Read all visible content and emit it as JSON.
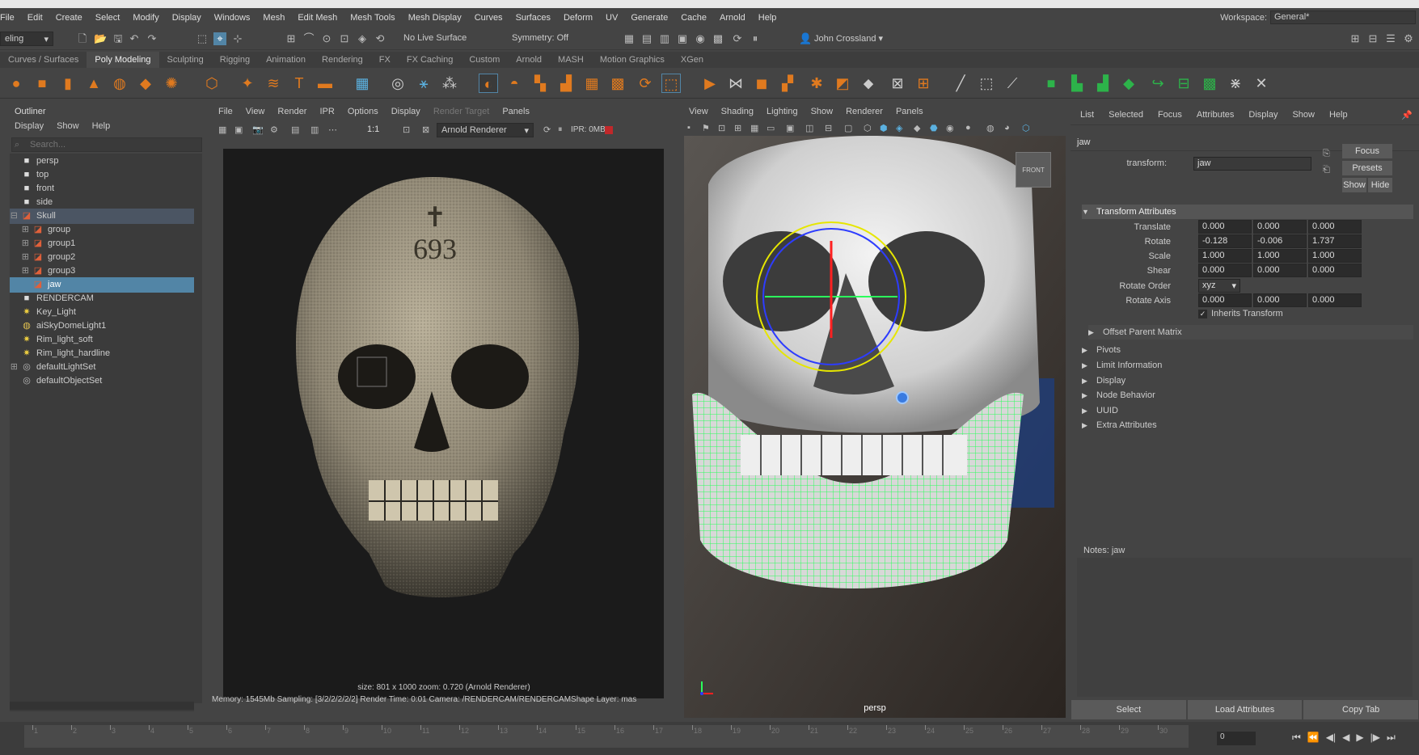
{
  "menubar": {
    "items": [
      "File",
      "Edit",
      "Create",
      "Select",
      "Modify",
      "Display",
      "Windows",
      "Mesh",
      "Edit Mesh",
      "Mesh Tools",
      "Mesh Display",
      "Curves",
      "Surfaces",
      "Deform",
      "UV",
      "Generate",
      "Cache",
      "Arnold",
      "Help"
    ],
    "workspace_label": "Workspace:",
    "workspace_value": "General*"
  },
  "toolbar": {
    "mode": "eling",
    "live_surface": "No Live Surface",
    "symmetry": "Symmetry: Off",
    "user": "John Crossland"
  },
  "shelf": {
    "tabs": [
      "Curves / Surfaces",
      "Poly Modeling",
      "Sculpting",
      "Rigging",
      "Animation",
      "Rendering",
      "FX",
      "FX Caching",
      "Custom",
      "Arnold",
      "MASH",
      "Motion Graphics",
      "XGen"
    ],
    "active": "Poly Modeling"
  },
  "outliner": {
    "title": "Outliner",
    "menu": [
      "Display",
      "Show",
      "Help"
    ],
    "search_placeholder": "Search...",
    "items": [
      {
        "label": "persp",
        "indent": 1,
        "icon": "camera-icon"
      },
      {
        "label": "top",
        "indent": 1,
        "icon": "camera-icon"
      },
      {
        "label": "front",
        "indent": 1,
        "icon": "camera-icon"
      },
      {
        "label": "side",
        "indent": 1,
        "icon": "camera-icon"
      },
      {
        "label": "Skull",
        "indent": 1,
        "icon": "mesh-icon",
        "expander": "⊟",
        "state": "hl"
      },
      {
        "label": "group",
        "indent": 2,
        "icon": "mesh-icon",
        "expander": "⊞"
      },
      {
        "label": "group1",
        "indent": 2,
        "icon": "mesh-icon",
        "expander": "⊞"
      },
      {
        "label": "group2",
        "indent": 2,
        "icon": "mesh-icon",
        "expander": "⊞"
      },
      {
        "label": "group3",
        "indent": 2,
        "icon": "mesh-icon",
        "expander": "⊞"
      },
      {
        "label": "jaw",
        "indent": 2,
        "icon": "mesh-icon",
        "state": "sel"
      },
      {
        "label": "RENDERCAM",
        "indent": 1,
        "icon": "camera-icon"
      },
      {
        "label": "Key_Light",
        "indent": 1,
        "icon": "light-icon"
      },
      {
        "label": "aiSkyDomeLight1",
        "indent": 1,
        "icon": "skydome-icon"
      },
      {
        "label": "Rim_light_soft",
        "indent": 1,
        "icon": "light-icon"
      },
      {
        "label": "Rim_light_hardline",
        "indent": 1,
        "icon": "light-icon"
      },
      {
        "label": "defaultLightSet",
        "indent": 1,
        "icon": "set-icon",
        "expander": "⊞"
      },
      {
        "label": "defaultObjectSet",
        "indent": 1,
        "icon": "set-icon"
      }
    ]
  },
  "render_view": {
    "menu": [
      "File",
      "View",
      "Render",
      "IPR",
      "Options",
      "Display",
      "Render Target",
      "Panels"
    ],
    "ratio": "1:1",
    "renderer": "Arnold Renderer",
    "ipr": "IPR: 0MB",
    "skull_text": "693",
    "size_info": "size: 801 x 1000 zoom: 0.720   (Arnold Renderer)",
    "status": "Memory: 1545Mb   Sampling: [3/2/2/2/2/2]   Render Time: 0:01   Camera: /RENDERCAM/RENDERCAMShape   Layer: mas"
  },
  "viewport": {
    "menu": [
      "View",
      "Shading",
      "Lighting",
      "Show",
      "Renderer",
      "Panels"
    ],
    "camera_label": "persp",
    "cube_label": "FRONT"
  },
  "attribute_editor": {
    "menu": [
      "List",
      "Selected",
      "Focus",
      "Attributes",
      "Display",
      "Show",
      "Help"
    ],
    "tab": "jaw",
    "transform_label": "transform:",
    "transform_value": "jaw",
    "buttons": {
      "focus": "Focus",
      "presets": "Presets",
      "show": "Show",
      "hide": "Hide"
    },
    "section": "Transform Attributes",
    "rows": [
      {
        "label": "Translate",
        "values": [
          "0.000",
          "0.000",
          "0.000"
        ]
      },
      {
        "label": "Rotate",
        "values": [
          "-0.128",
          "-0.006",
          "1.737"
        ]
      },
      {
        "label": "Scale",
        "values": [
          "1.000",
          "1.000",
          "1.000"
        ]
      },
      {
        "label": "Shear",
        "values": [
          "0.000",
          "0.000",
          "0.000"
        ]
      }
    ],
    "rotate_order_label": "Rotate Order",
    "rotate_order": "xyz",
    "rotate_axis_label": "Rotate Axis",
    "rotate_axis": [
      "0.000",
      "0.000",
      "0.000"
    ],
    "inherits": "Inherits Transform",
    "collapsed": [
      "Offset Parent Matrix",
      "Pivots",
      "Limit Information",
      "Display",
      "Node Behavior",
      "UUID",
      "Extra Attributes"
    ],
    "notes": "Notes: jaw",
    "bottom": [
      "Select",
      "Load Attributes",
      "Copy Tab"
    ]
  },
  "timeline": {
    "numbers": [
      "1",
      "2",
      "3",
      "4",
      "5",
      "6",
      "7",
      "8",
      "9",
      "10",
      "11",
      "12",
      "13",
      "14",
      "15",
      "16",
      "17",
      "18",
      "19",
      "20",
      "21",
      "22",
      "23",
      "24",
      "25",
      "26",
      "27",
      "28",
      "29",
      "30"
    ],
    "current": "0"
  },
  "colors": {
    "selection": "#5285a6",
    "wire": "#2bff5c",
    "accent": "#5285a6"
  }
}
